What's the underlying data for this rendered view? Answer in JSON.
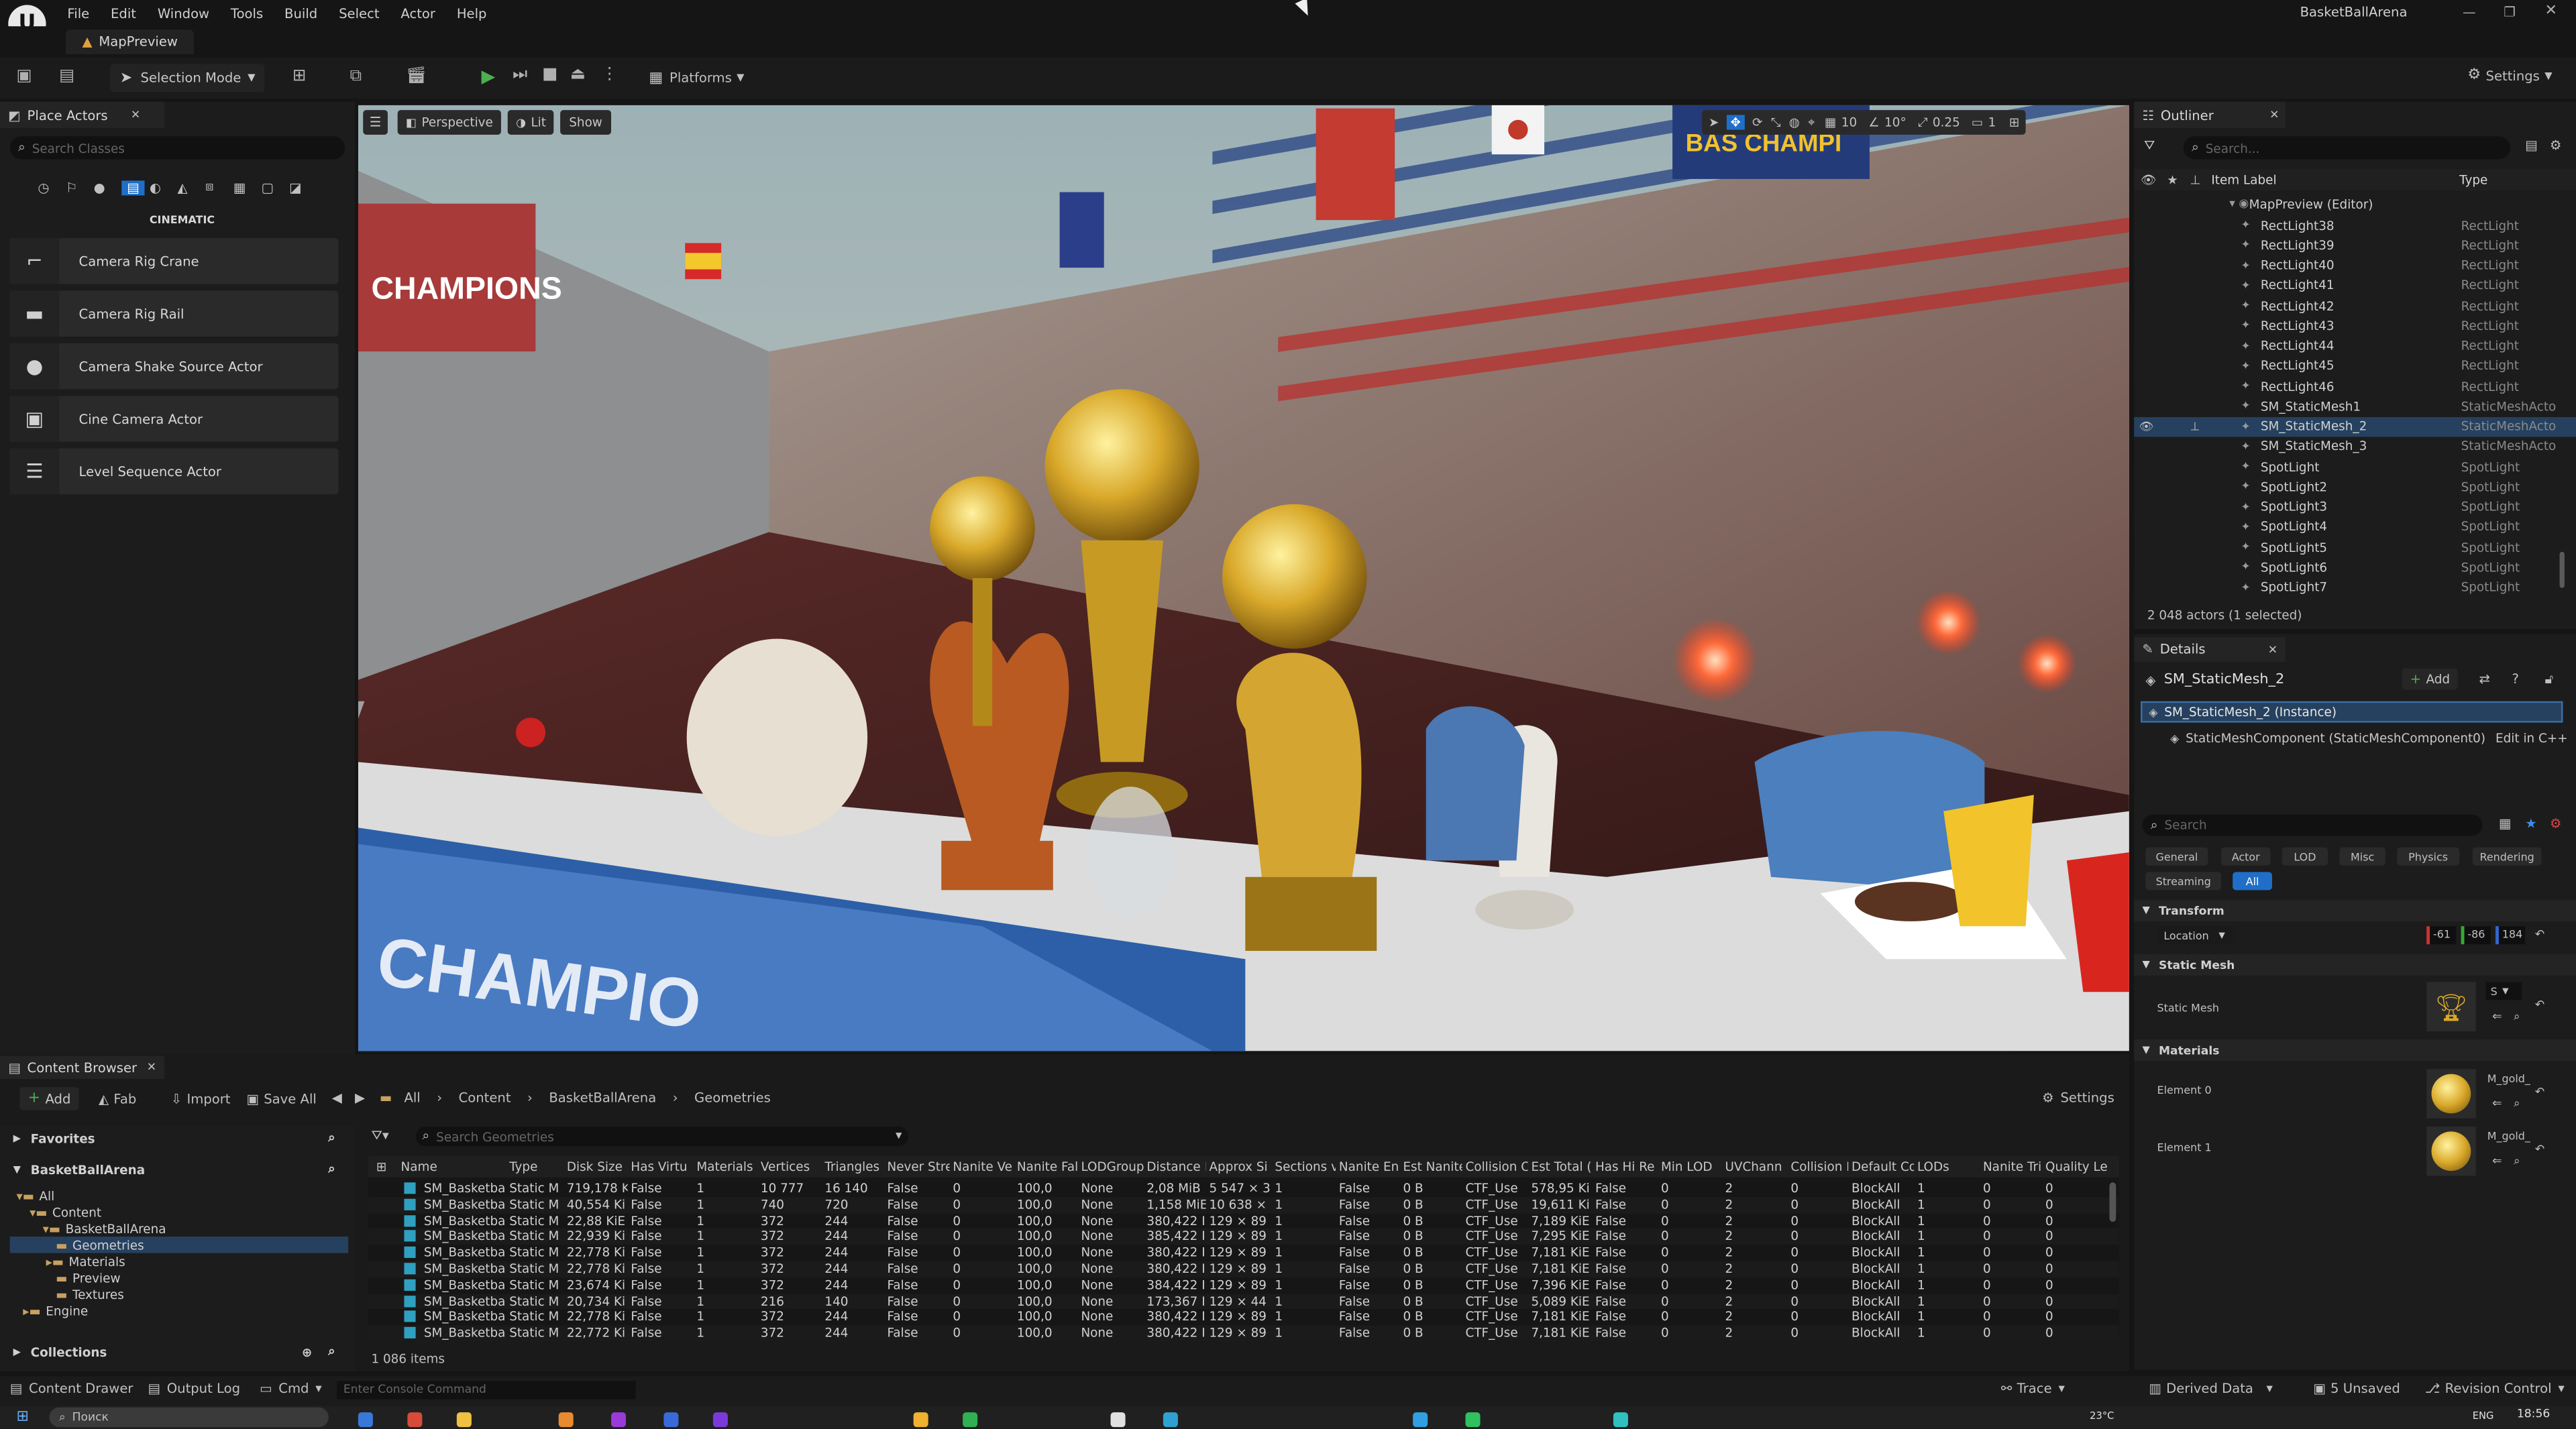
{
  "window": {
    "project": "BasketBallArena",
    "tab": "MapPreview"
  },
  "menu": [
    "File",
    "Edit",
    "Window",
    "Tools",
    "Build",
    "Select",
    "Actor",
    "Help"
  ],
  "toolbar": {
    "selection_mode": "Selection Mode",
    "platforms": "Platforms",
    "settings": "Settings"
  },
  "place_actors": {
    "title": "Place Actors",
    "search_placeholder": "Search Classes",
    "category": "CINEMATIC",
    "items": [
      "Camera Rig Crane",
      "Camera Rig Rail",
      "Camera Shake Source Actor",
      "Cine Camera Actor",
      "Level Sequence Actor"
    ]
  },
  "viewport": {
    "perspective": "Perspective",
    "lit": "Lit",
    "show": "Show",
    "grid": "10",
    "rot": "10°",
    "scale": "0.25",
    "cams": "1",
    "banner": "CHAMPIONS",
    "floor_text": "CHAMPIO",
    "corner": "BAS CHAMPI"
  },
  "outliner": {
    "title": "Outliner",
    "search_placeholder": "Search...",
    "col_label": "Item Label",
    "col_type": "Type",
    "root": "MapPreview (Editor)",
    "rows": [
      [
        "RectLight38",
        "RectLight"
      ],
      [
        "RectLight39",
        "RectLight"
      ],
      [
        "RectLight40",
        "RectLight"
      ],
      [
        "RectLight41",
        "RectLight"
      ],
      [
        "RectLight42",
        "RectLight"
      ],
      [
        "RectLight43",
        "RectLight"
      ],
      [
        "RectLight44",
        "RectLight"
      ],
      [
        "RectLight45",
        "RectLight"
      ],
      [
        "RectLight46",
        "RectLight"
      ],
      [
        "SM_StaticMesh1",
        "StaticMeshActo"
      ],
      [
        "SM_StaticMesh_2",
        "StaticMeshActo"
      ],
      [
        "SM_StaticMesh_3",
        "StaticMeshActo"
      ],
      [
        "SpotLight",
        "SpotLight"
      ],
      [
        "SpotLight2",
        "SpotLight"
      ],
      [
        "SpotLight3",
        "SpotLight"
      ],
      [
        "SpotLight4",
        "SpotLight"
      ],
      [
        "SpotLight5",
        "SpotLight"
      ],
      [
        "SpotLight6",
        "SpotLight"
      ],
      [
        "SpotLight7",
        "SpotLight"
      ]
    ],
    "selected_index": 10,
    "count": "2 048 actors (1 selected)"
  },
  "details": {
    "title": "Details",
    "actor": "SM_StaticMesh_2",
    "add": "Add",
    "instance": "SM_StaticMesh_2 (Instance)",
    "component": "StaticMeshComponent (StaticMeshComponent0)",
    "edit_cpp": "Edit in C++",
    "search_placeholder": "Search",
    "tabs": [
      "General",
      "Actor",
      "LOD",
      "Misc",
      "Physics",
      "Rendering",
      "Streaming",
      "All"
    ],
    "transform": "Transform",
    "location": "Location",
    "loc": [
      "-61",
      "-86",
      "184"
    ],
    "static_mesh_section": "Static Mesh",
    "static_mesh_label": "Static Mesh",
    "static_mesh_value": "S",
    "materials": "Materials",
    "element0": "Element 0",
    "element1": "Element 1",
    "mat0": "M_gold_",
    "mat1": "M_gold_"
  },
  "content_browser": {
    "title": "Content Browser",
    "add": "Add",
    "fab": "Fab",
    "import": "Import",
    "save_all": "Save All",
    "path": [
      "All",
      "Content",
      "BasketBallArena",
      "Geometries"
    ],
    "settings": "Settings",
    "favorites": "Favorites",
    "project": "BasketBallArena",
    "tree": [
      "All",
      "Content",
      "BasketBallArena",
      "Geometries",
      "Materials",
      "Preview",
      "Textures",
      "Engine"
    ],
    "collections": "Collections",
    "search_placeholder": "Search Geometries",
    "items_count": "1 086 items",
    "columns": [
      "Name",
      "Type",
      "Disk Size",
      "Has Virtu",
      "Materials",
      "Vertices",
      "Triangles",
      "Never Stre",
      "Nanite Ve",
      "Nanite Fal",
      "LODGroup",
      "Distance I",
      "Approx Si",
      "Sections v",
      "Nanite En",
      "Est Nanite",
      "Collision C",
      "Est Total (",
      "Has Hi Re",
      "Min LOD",
      "UVChann",
      "Collision F",
      "Default Co",
      "LODs",
      "Nanite Tri",
      "Quality Le"
    ],
    "rows": [
      [
        "SM_Basketba",
        "Static M",
        "719,178 Ki",
        "False",
        "1",
        "10 777",
        "16 140",
        "False",
        "0",
        "100,0",
        "None",
        "2,08 MiB",
        "5 547 × 3",
        "1",
        "False",
        "0 B",
        "CTF_Use",
        "578,95 Ki",
        "False",
        "0",
        "2",
        "0",
        "BlockAll",
        "1",
        "0",
        "0"
      ],
      [
        "SM_Basketba",
        "Static M",
        "40,554 Ki",
        "False",
        "1",
        "740",
        "720",
        "False",
        "0",
        "100,0",
        "None",
        "1,158 MiE",
        "10 638 ×",
        "1",
        "False",
        "0 B",
        "CTF_Use",
        "19,611 Ki",
        "False",
        "0",
        "2",
        "0",
        "BlockAll",
        "1",
        "0",
        "0"
      ],
      [
        "SM_Basketba",
        "Static M",
        "22,88 KiE",
        "False",
        "1",
        "372",
        "244",
        "False",
        "0",
        "100,0",
        "None",
        "380,422 I",
        "129 × 89",
        "1",
        "False",
        "0 B",
        "CTF_Use",
        "7,189 KiE",
        "False",
        "0",
        "2",
        "0",
        "BlockAll",
        "1",
        "0",
        "0"
      ],
      [
        "SM_Basketba",
        "Static M",
        "22,939 Ki",
        "False",
        "1",
        "372",
        "244",
        "False",
        "0",
        "100,0",
        "None",
        "385,422 I",
        "129 × 89",
        "1",
        "False",
        "0 B",
        "CTF_Use",
        "7,295 KiE",
        "False",
        "0",
        "2",
        "0",
        "BlockAll",
        "1",
        "0",
        "0"
      ],
      [
        "SM_Basketba",
        "Static M",
        "22,778 Ki",
        "False",
        "1",
        "372",
        "244",
        "False",
        "0",
        "100,0",
        "None",
        "380,422 I",
        "129 × 89",
        "1",
        "False",
        "0 B",
        "CTF_Use",
        "7,181 KiE",
        "False",
        "0",
        "2",
        "0",
        "BlockAll",
        "1",
        "0",
        "0"
      ],
      [
        "SM_Basketba",
        "Static M",
        "22,778 Ki",
        "False",
        "1",
        "372",
        "244",
        "False",
        "0",
        "100,0",
        "None",
        "380,422 I",
        "129 × 89",
        "1",
        "False",
        "0 B",
        "CTF_Use",
        "7,181 KiE",
        "False",
        "0",
        "2",
        "0",
        "BlockAll",
        "1",
        "0",
        "0"
      ],
      [
        "SM_Basketba",
        "Static M",
        "23,674 Ki",
        "False",
        "1",
        "372",
        "244",
        "False",
        "0",
        "100,0",
        "None",
        "384,422 I",
        "129 × 89",
        "1",
        "False",
        "0 B",
        "CTF_Use",
        "7,396 KiE",
        "False",
        "0",
        "2",
        "0",
        "BlockAll",
        "1",
        "0",
        "0"
      ],
      [
        "SM_Basketba",
        "Static M",
        "20,734 Ki",
        "False",
        "1",
        "216",
        "140",
        "False",
        "0",
        "100,0",
        "None",
        "173,367 I",
        "129 × 44",
        "1",
        "False",
        "0 B",
        "CTF_Use",
        "5,089 KiE",
        "False",
        "0",
        "2",
        "0",
        "BlockAll",
        "1",
        "0",
        "0"
      ],
      [
        "SM_Basketba",
        "Static M",
        "22,778 Ki",
        "False",
        "1",
        "372",
        "244",
        "False",
        "0",
        "100,0",
        "None",
        "380,422 I",
        "129 × 89",
        "1",
        "False",
        "0 B",
        "CTF_Use",
        "7,181 KiE",
        "False",
        "0",
        "2",
        "0",
        "BlockAll",
        "1",
        "0",
        "0"
      ],
      [
        "SM_Basketba",
        "Static M",
        "22,772 Ki",
        "False",
        "1",
        "372",
        "244",
        "False",
        "0",
        "100,0",
        "None",
        "380,422 I",
        "129 × 89",
        "1",
        "False",
        "0 B",
        "CTF_Use",
        "7,181 KiE",
        "False",
        "0",
        "2",
        "0",
        "BlockAll",
        "1",
        "0",
        "0"
      ]
    ]
  },
  "status": {
    "content_drawer": "Content Drawer",
    "output_log": "Output Log",
    "cmd": "Cmd",
    "console_placeholder": "Enter Console Command",
    "trace": "Trace",
    "derived": "Derived Data",
    "unsaved": "5 Unsaved",
    "revision": "Revision Control"
  },
  "taskbar": {
    "search": "Поиск",
    "clock": "18:56",
    "lang": "ENG",
    "weather": "23°C"
  },
  "colors": {
    "accent": "#0070e0",
    "selected_row": "#26415f",
    "play": "#4caf50"
  }
}
